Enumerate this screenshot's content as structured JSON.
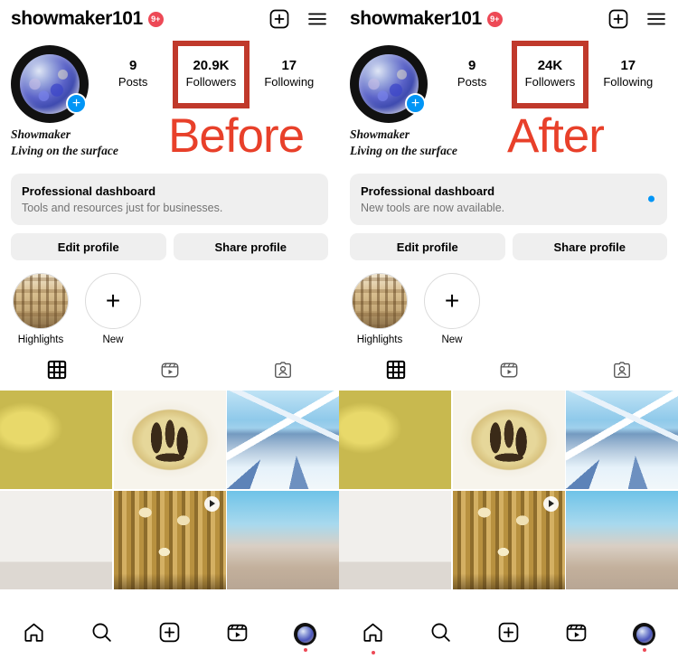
{
  "panels": [
    {
      "key": "before",
      "comparison_label": "Before",
      "topbar": {
        "username": "showmaker101",
        "notification_badge": "9+",
        "add_icon": "plus-square-icon",
        "menu_icon": "hamburger-menu-icon"
      },
      "stats": [
        {
          "value": "9",
          "label": "Posts",
          "highlighted": false
        },
        {
          "value": "20.9K",
          "label": "Followers",
          "highlighted": true
        },
        {
          "value": "17",
          "label": "Following",
          "highlighted": false
        }
      ],
      "bio": {
        "name": "Showmaker",
        "line": "Living on the surface"
      },
      "dashboard": {
        "title": "Professional dashboard",
        "subtitle": "Tools and resources just for businesses.",
        "has_dot": false
      },
      "actions": [
        "Edit profile",
        "Share profile"
      ],
      "highlights": [
        {
          "label": "Highlights",
          "art": "art-dollhouse",
          "type": "cover"
        },
        {
          "label": "New",
          "art": "",
          "type": "new"
        }
      ],
      "tabs": [
        {
          "name": "grid-tab",
          "icon": "grid-icon",
          "active": true
        },
        {
          "name": "reels-tab",
          "icon": "reels-icon",
          "active": false
        },
        {
          "name": "tagged-tab",
          "icon": "tagged-person-icon",
          "active": false
        }
      ],
      "grid": [
        {
          "art": "art-food",
          "alt": "hotpot-meal-photo",
          "is_reel": false
        },
        {
          "art": "art-pizza",
          "alt": "truffle-pizza-photo",
          "is_reel": false
        },
        {
          "art": "art-mountain",
          "alt": "snowy-mountain-photo",
          "is_reel": false
        },
        {
          "art": "art-bears",
          "alt": "bearbrick-figures-photo",
          "is_reel": false
        },
        {
          "art": "art-dollhouse",
          "alt": "ornate-dollhouse-photo",
          "is_reel": true
        },
        {
          "art": "art-balloons",
          "alt": "hot-air-balloons-photo",
          "is_reel": false
        }
      ],
      "bottomnav": [
        {
          "icon": "home-icon",
          "dot": false
        },
        {
          "icon": "search-icon",
          "dot": false
        },
        {
          "icon": "create-plus-icon",
          "dot": false
        },
        {
          "icon": "reels-icon",
          "dot": false
        },
        {
          "icon": "profile-avatar-icon",
          "dot": true
        }
      ]
    },
    {
      "key": "after",
      "comparison_label": "After",
      "topbar": {
        "username": "showmaker101",
        "notification_badge": "9+",
        "add_icon": "plus-square-icon",
        "menu_icon": "hamburger-menu-icon"
      },
      "stats": [
        {
          "value": "9",
          "label": "Posts",
          "highlighted": false
        },
        {
          "value": "24K",
          "label": "Followers",
          "highlighted": true
        },
        {
          "value": "17",
          "label": "Following",
          "highlighted": false
        }
      ],
      "bio": {
        "name": "Showmaker",
        "line": "Living on the surface"
      },
      "dashboard": {
        "title": "Professional dashboard",
        "subtitle": "New tools are now available.",
        "has_dot": true
      },
      "actions": [
        "Edit profile",
        "Share profile"
      ],
      "highlights": [
        {
          "label": "Highlights",
          "art": "art-dollhouse",
          "type": "cover"
        },
        {
          "label": "New",
          "art": "",
          "type": "new"
        }
      ],
      "tabs": [
        {
          "name": "grid-tab",
          "icon": "grid-icon",
          "active": true
        },
        {
          "name": "reels-tab",
          "icon": "reels-icon",
          "active": false
        },
        {
          "name": "tagged-tab",
          "icon": "tagged-person-icon",
          "active": false
        }
      ],
      "grid": [
        {
          "art": "art-food",
          "alt": "hotpot-meal-photo",
          "is_reel": false
        },
        {
          "art": "art-pizza",
          "alt": "truffle-pizza-photo",
          "is_reel": false
        },
        {
          "art": "art-mountain",
          "alt": "snowy-mountain-photo",
          "is_reel": false
        },
        {
          "art": "art-bears",
          "alt": "bearbrick-figures-photo",
          "is_reel": false
        },
        {
          "art": "art-dollhouse",
          "alt": "ornate-dollhouse-photo",
          "is_reel": true
        },
        {
          "art": "art-balloons",
          "alt": "hot-air-balloons-photo",
          "is_reel": false
        }
      ],
      "bottomnav": [
        {
          "icon": "home-icon",
          "dot": true
        },
        {
          "icon": "search-icon",
          "dot": false
        },
        {
          "icon": "create-plus-icon",
          "dot": false
        },
        {
          "icon": "reels-icon",
          "dot": false
        },
        {
          "icon": "profile-avatar-icon",
          "dot": true
        }
      ]
    }
  ],
  "colors": {
    "annotation_box": "#C0392B",
    "annotation_text": "#E8402A",
    "instagram_blue": "#0095F6",
    "notification_red": "#ED4956",
    "card_grey": "#EFEFEF",
    "subtext_grey": "#737373"
  }
}
